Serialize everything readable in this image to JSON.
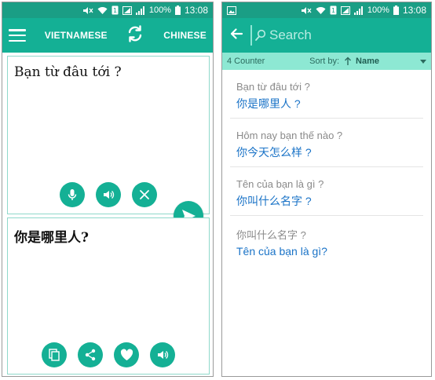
{
  "status": {
    "battery": "100%",
    "time": "13:08"
  },
  "left": {
    "source_lang": "VIETNAMESE",
    "target_lang": "CHINESE",
    "source_text": "Bạn từ đâu tới ?",
    "target_text": "你是哪里人?"
  },
  "right": {
    "search_placeholder": "Search",
    "counter": "4 Counter",
    "sort_by_label": "Sort by:",
    "sort_field": "Name",
    "items": [
      {
        "src": "Bạn từ đâu tới ?",
        "dst": "你是哪里人 ?"
      },
      {
        "src": "Hôm nay bạn thế nào ?",
        "dst": "你今天怎么样 ?"
      },
      {
        "src": "Tên của bạn là gì ?",
        "dst": "你叫什么名字 ?"
      },
      {
        "src": "你叫什么名字 ?",
        "dst": "Tên của bạn là gì?"
      }
    ]
  },
  "colors": {
    "statusbar": "#1a9e85",
    "appbar": "#14b095",
    "sortbar": "#8de8d3",
    "link": "#1a73c7"
  }
}
